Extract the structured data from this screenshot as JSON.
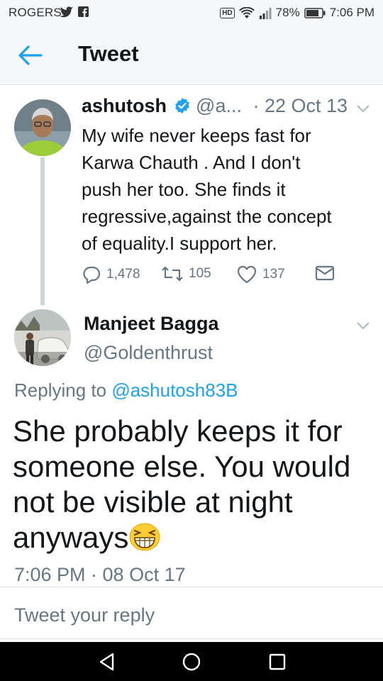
{
  "status_bar": {
    "carrier": "ROGERS",
    "hd": "HD",
    "battery": "78%",
    "time": "7:06 PM"
  },
  "header": {
    "title": "Tweet"
  },
  "original_tweet": {
    "author_name": "ashutosh",
    "handle": "@a...",
    "date": "· 22 Oct 13",
    "lines": [
      "My wife never keeps fast for",
      "Karwa Chauth . And I don't",
      "push her too. She finds it",
      "regressive,against the concept",
      "of equality.I support her."
    ],
    "replies": "1,478",
    "retweets": "105",
    "likes": "137"
  },
  "reply_tweet": {
    "author_name": "Manjeet Bagga",
    "handle": "@Goldenthrust",
    "replying_prefix": "Replying to",
    "replying_handle": "@ashutosh83B",
    "lines": [
      "She probably keeps it for",
      "someone else. You would",
      "not be visible at night",
      "anyways"
    ],
    "timestamp": "7:06 PM · 08 Oct 17"
  },
  "reply_bar": {
    "placeholder": "Tweet your reply"
  },
  "colors": {
    "accent": "#1da1f2",
    "muted": "#657786",
    "text": "#14171a"
  }
}
